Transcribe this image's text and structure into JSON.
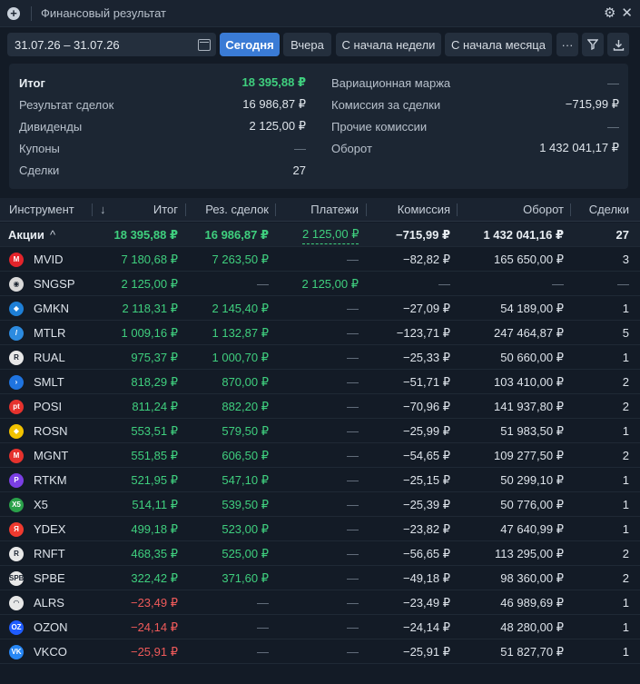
{
  "window": {
    "title": "Финансовый результат",
    "icons": [
      "plus-circle-icon",
      "gear-icon",
      "close-icon"
    ]
  },
  "toolbar": {
    "date_range": "31.07.26 – 31.07.26",
    "buttons": [
      "Сегодня",
      "Вчера",
      "С начала недели",
      "С начала месяца"
    ],
    "active_button": "Сегодня",
    "more_label": "···",
    "icons": [
      "calendar-icon",
      "more-icon",
      "filter-icon",
      "download-icon"
    ]
  },
  "summary": {
    "left": [
      {
        "label": "Итог",
        "value": "18 395,88 ₽"
      },
      {
        "label": "Результат сделок",
        "value": "16 986,87 ₽"
      },
      {
        "label": "Дивиденды",
        "value": "2 125,00 ₽"
      },
      {
        "label": "Купоны",
        "value": "—"
      },
      {
        "label": "Сделки",
        "value": "27"
      }
    ],
    "right": [
      {
        "label": "Вариационная маржа",
        "value": "—"
      },
      {
        "label": "Комиссия за сделки",
        "value": "−715,99 ₽"
      },
      {
        "label": "Прочие комиссии",
        "value": "—"
      },
      {
        "label": "Оборот",
        "value": "1 432 041,17 ₽"
      }
    ]
  },
  "table": {
    "headers": {
      "instrument": "Инструмент",
      "sort_arrow": "↓",
      "total": "Итог",
      "deals_result": "Рез. сделок",
      "payments": "Платежи",
      "commission": "Комиссия",
      "turnover": "Оборот",
      "deals": "Сделки"
    },
    "group": {
      "name": "Акции",
      "chevron": "^",
      "total": "18 395,88 ₽",
      "deals_result": "16 986,87 ₽",
      "payments": "2 125,00 ₽",
      "commission": "−715,99 ₽",
      "turnover": "1 432 041,16 ₽",
      "deals": "27"
    },
    "rows": [
      {
        "ticker": "MVID",
        "logo": "М",
        "color": "#e3242b",
        "total": "7 180,68 ₽",
        "deals_result": "7 263,50 ₽",
        "payments": "—",
        "commission": "−82,82 ₽",
        "turnover": "165 650,00 ₽",
        "deals": "3"
      },
      {
        "ticker": "SNGSP",
        "logo": "◉",
        "color": "#d9d9d9",
        "total": "2 125,00 ₽",
        "deals_result": "—",
        "payments": "2 125,00 ₽",
        "commission": "—",
        "turnover": "—",
        "deals": "—"
      },
      {
        "ticker": "GMKN",
        "logo": "◆",
        "color": "#1e7fd6",
        "total": "2 118,31 ₽",
        "deals_result": "2 145,40 ₽",
        "payments": "—",
        "commission": "−27,09 ₽",
        "turnover": "54 189,00 ₽",
        "deals": "1"
      },
      {
        "ticker": "MTLR",
        "logo": "/",
        "color": "#2c8be0",
        "total": "1 009,16 ₽",
        "deals_result": "1 132,87 ₽",
        "payments": "—",
        "commission": "−123,71 ₽",
        "turnover": "247 464,87 ₽",
        "deals": "5"
      },
      {
        "ticker": "RUAL",
        "logo": "R",
        "color": "#e8e8e8",
        "total": "975,37 ₽",
        "deals_result": "1 000,70 ₽",
        "payments": "—",
        "commission": "−25,33 ₽",
        "turnover": "50 660,00 ₽",
        "deals": "1"
      },
      {
        "ticker": "SMLT",
        "logo": "›",
        "color": "#1f74e0",
        "total": "818,29 ₽",
        "deals_result": "870,00 ₽",
        "payments": "—",
        "commission": "−51,71 ₽",
        "turnover": "103 410,00 ₽",
        "deals": "2"
      },
      {
        "ticker": "POSI",
        "logo": "pt",
        "color": "#e5322d",
        "total": "811,24 ₽",
        "deals_result": "882,20 ₽",
        "payments": "—",
        "commission": "−70,96 ₽",
        "turnover": "141 937,80 ₽",
        "deals": "2"
      },
      {
        "ticker": "ROSN",
        "logo": "◆",
        "color": "#f2c200",
        "total": "553,51 ₽",
        "deals_result": "579,50 ₽",
        "payments": "—",
        "commission": "−25,99 ₽",
        "turnover": "51 983,50 ₽",
        "deals": "1"
      },
      {
        "ticker": "MGNT",
        "logo": "М",
        "color": "#e5322d",
        "total": "551,85 ₽",
        "deals_result": "606,50 ₽",
        "payments": "—",
        "commission": "−54,65 ₽",
        "turnover": "109 277,50 ₽",
        "deals": "2"
      },
      {
        "ticker": "RTKM",
        "logo": "P",
        "color": "#7b3fe4",
        "total": "521,95 ₽",
        "deals_result": "547,10 ₽",
        "payments": "—",
        "commission": "−25,15 ₽",
        "turnover": "50 299,10 ₽",
        "deals": "1"
      },
      {
        "ticker": "X5",
        "logo": "X5",
        "color": "#2aa14a",
        "total": "514,11 ₽",
        "deals_result": "539,50 ₽",
        "payments": "—",
        "commission": "−25,39 ₽",
        "turnover": "50 776,00 ₽",
        "deals": "1"
      },
      {
        "ticker": "YDEX",
        "logo": "Я",
        "color": "#f03a2f",
        "total": "499,18 ₽",
        "deals_result": "523,00 ₽",
        "payments": "—",
        "commission": "−23,82 ₽",
        "turnover": "47 640,99 ₽",
        "deals": "1"
      },
      {
        "ticker": "RNFT",
        "logo": "R",
        "color": "#e8e8e8",
        "total": "468,35 ₽",
        "deals_result": "525,00 ₽",
        "payments": "—",
        "commission": "−56,65 ₽",
        "turnover": "113 295,00 ₽",
        "deals": "2"
      },
      {
        "ticker": "SPBE",
        "logo": "SPB",
        "color": "#e8e8e8",
        "total": "322,42 ₽",
        "deals_result": "371,60 ₽",
        "payments": "—",
        "commission": "−49,18 ₽",
        "turnover": "98 360,00 ₽",
        "deals": "2"
      },
      {
        "ticker": "ALRS",
        "logo": "◠",
        "color": "#e8e8e8",
        "total": "−23,49 ₽",
        "deals_result": "—",
        "payments": "—",
        "commission": "−23,49 ₽",
        "turnover": "46 989,69 ₽",
        "deals": "1",
        "negative": true
      },
      {
        "ticker": "OZON",
        "logo": "OZ",
        "color": "#1f5cff",
        "total": "−24,14 ₽",
        "deals_result": "—",
        "payments": "—",
        "commission": "−24,14 ₽",
        "turnover": "48 280,00 ₽",
        "deals": "1",
        "negative": true
      },
      {
        "ticker": "VKCO",
        "logo": "VK",
        "color": "#2787f5",
        "total": "−25,91 ₽",
        "deals_result": "—",
        "payments": "—",
        "commission": "−25,91 ₽",
        "turnover": "51 827,70 ₽",
        "deals": "1",
        "negative": true
      }
    ]
  },
  "colors": {
    "accent": "#3a7bd5",
    "positive": "#3fcf7e",
    "negative": "#ef5a5a",
    "background": "#131b26"
  }
}
